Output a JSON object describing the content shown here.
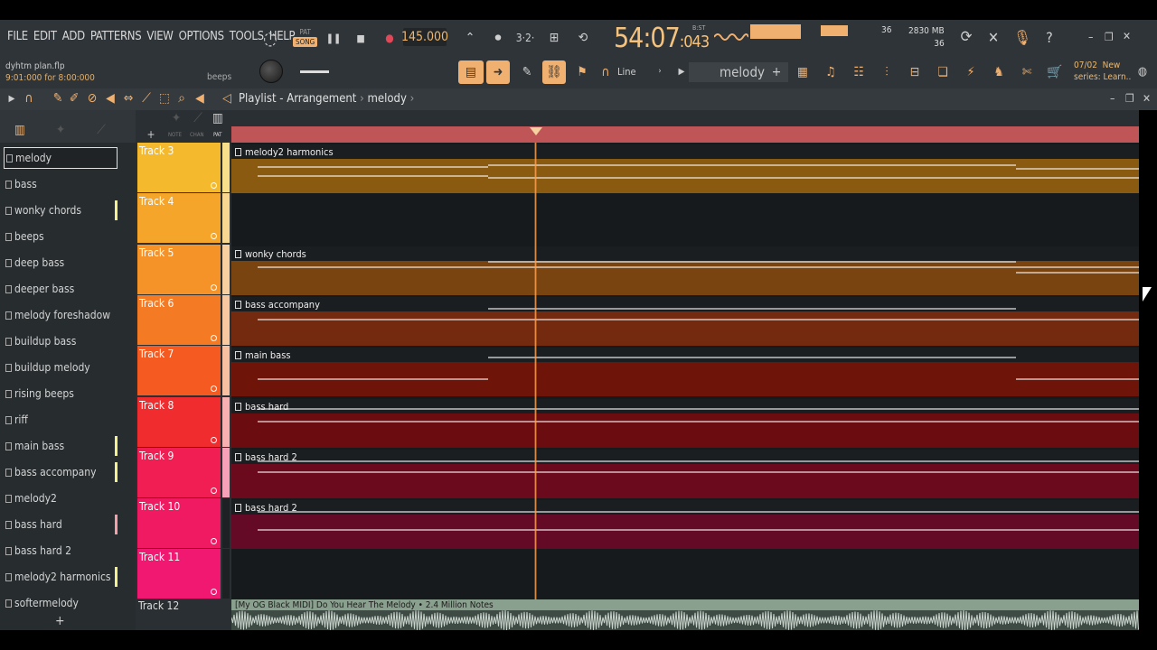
{
  "menu": [
    "FILE",
    "EDIT",
    "ADD",
    "PATTERNS",
    "VIEW",
    "OPTIONS",
    "TOOLS",
    "HELP"
  ],
  "project": {
    "file": "dyhtm plan.flp",
    "time": "9:01:000 for 8:00:000"
  },
  "hint_channel": "beeps",
  "transport": {
    "pat_label": "PAT",
    "song_label": "SONG",
    "tempo": "145.000"
  },
  "time_display": {
    "main": "54:07",
    "sub": "043",
    "unit": "B:ST"
  },
  "cpu": {
    "value": "36",
    "mem": "2830 MB",
    "poly": "36"
  },
  "news": {
    "date": "07/02",
    "line1": "New",
    "line2": "series: Learn.."
  },
  "snap": "Line",
  "current_pattern": "melody",
  "playlist": {
    "title": "Playlist - Arrangement",
    "crumb": "melody"
  },
  "patterns": [
    {
      "label": "melody",
      "bar": ""
    },
    {
      "label": "bass",
      "bar": ""
    },
    {
      "label": "wonky chords",
      "bar": "#f5f08a"
    },
    {
      "label": "beeps",
      "bar": ""
    },
    {
      "label": "deep bass",
      "bar": ""
    },
    {
      "label": "deeper bass",
      "bar": ""
    },
    {
      "label": "melody foreshadow",
      "bar": ""
    },
    {
      "label": "buildup bass",
      "bar": ""
    },
    {
      "label": "buildup melody",
      "bar": ""
    },
    {
      "label": "rising beeps",
      "bar": ""
    },
    {
      "label": "riff",
      "bar": ""
    },
    {
      "label": "main bass",
      "bar": "#f5f08a"
    },
    {
      "label": "bass accompany",
      "bar": "#f5f08a"
    },
    {
      "label": "melody2",
      "bar": ""
    },
    {
      "label": "bass hard",
      "bar": "#f5a0a8"
    },
    {
      "label": "bass hard 2",
      "bar": ""
    },
    {
      "label": "melody2 harmonics",
      "bar": "#f5f08a"
    },
    {
      "label": "softermelody",
      "bar": ""
    }
  ],
  "tracks": [
    {
      "name": "Track 3",
      "color": "#f5b92e",
      "strip": "#f8e08a",
      "led": "#f5b92e"
    },
    {
      "name": "Track 4",
      "color": "#f5a52a",
      "strip": "#f8d890",
      "led": "#f5a52a"
    },
    {
      "name": "Track 5",
      "color": "#f59228",
      "strip": "#f8d0a0",
      "led": "#f59228"
    },
    {
      "name": "Track 6",
      "color": "#f57a24",
      "strip": "#f8c8a0",
      "led": "#f57a24"
    },
    {
      "name": "Track 7",
      "color": "#f55a20",
      "strip": "#f8c0a0",
      "led": "#f55a20"
    },
    {
      "name": "Track 8",
      "color": "#f02c2e",
      "strip": "#f8b0b0",
      "led": "#f02c2e"
    },
    {
      "name": "Track 9",
      "color": "#f01e52",
      "strip": "#f8a0b8",
      "led": "#f01e52"
    },
    {
      "name": "Track 10",
      "color": "#f01a62",
      "strip": "#1d2124",
      "led": "#f01a62"
    },
    {
      "name": "Track 11",
      "color": "#f01870",
      "strip": "#1d2124",
      "led": "#f01870"
    }
  ],
  "clips": [
    {
      "label": "melody2 harmonics",
      "track": 0,
      "color": "#8a5a10"
    },
    {
      "label": "wonky chords",
      "track": 2,
      "color": "#7a4410"
    },
    {
      "label": "bass accompany",
      "track": 3,
      "color": "#742a0e"
    },
    {
      "label": "main bass",
      "track": 4,
      "color": "#6e1408"
    },
    {
      "label": "bass hard",
      "track": 5,
      "color": "#6a0c10"
    },
    {
      "label": "bass hard 2",
      "track": 6,
      "color": "#6a0a1c"
    },
    {
      "label": "bass hard 2",
      "track": 7,
      "color": "#640a26"
    }
  ],
  "audio": {
    "track": "Track 12",
    "label": "[My OG Black MIDI] Do You Hear The Melody • 2.4 Million Notes"
  }
}
